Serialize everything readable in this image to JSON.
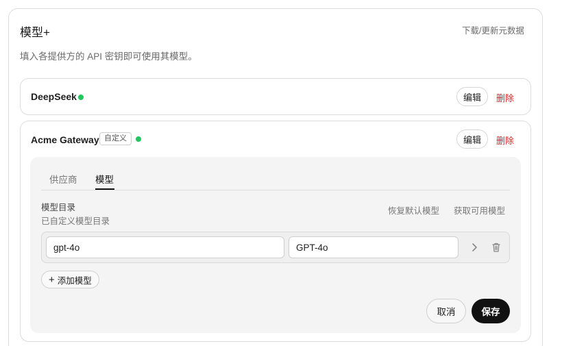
{
  "header": {
    "title": "模型+",
    "download_link": "下载/更新元数据",
    "subtitle": "填入各提供方的 API 密钥即可使用其模型。"
  },
  "providers": [
    {
      "name": "DeepSeek",
      "status_color": "#22c55e",
      "edit_label": "编辑",
      "delete_label": "删除"
    },
    {
      "name": "Acme Gateway",
      "tag": "自定义",
      "status_color": "#22c55e",
      "edit_label": "编辑",
      "delete_label": "删除"
    }
  ],
  "editor": {
    "tabs": [
      "供应商",
      "模型"
    ],
    "active_tab": "模型",
    "section_title": "模型目录",
    "section_subtitle": "已自定义模型目录",
    "restore_label": "恢复默认模型",
    "fetch_label": "获取可用模型",
    "models": [
      {
        "id": "gpt-4o",
        "display_name": "GPT-4o"
      }
    ],
    "add_label": "添加模型",
    "cancel_label": "取消",
    "save_label": "保存"
  },
  "icons": {
    "status": "status-dot-icon",
    "expand": "chevron-right-icon",
    "delete": "trash-icon",
    "add": "plus-icon"
  }
}
